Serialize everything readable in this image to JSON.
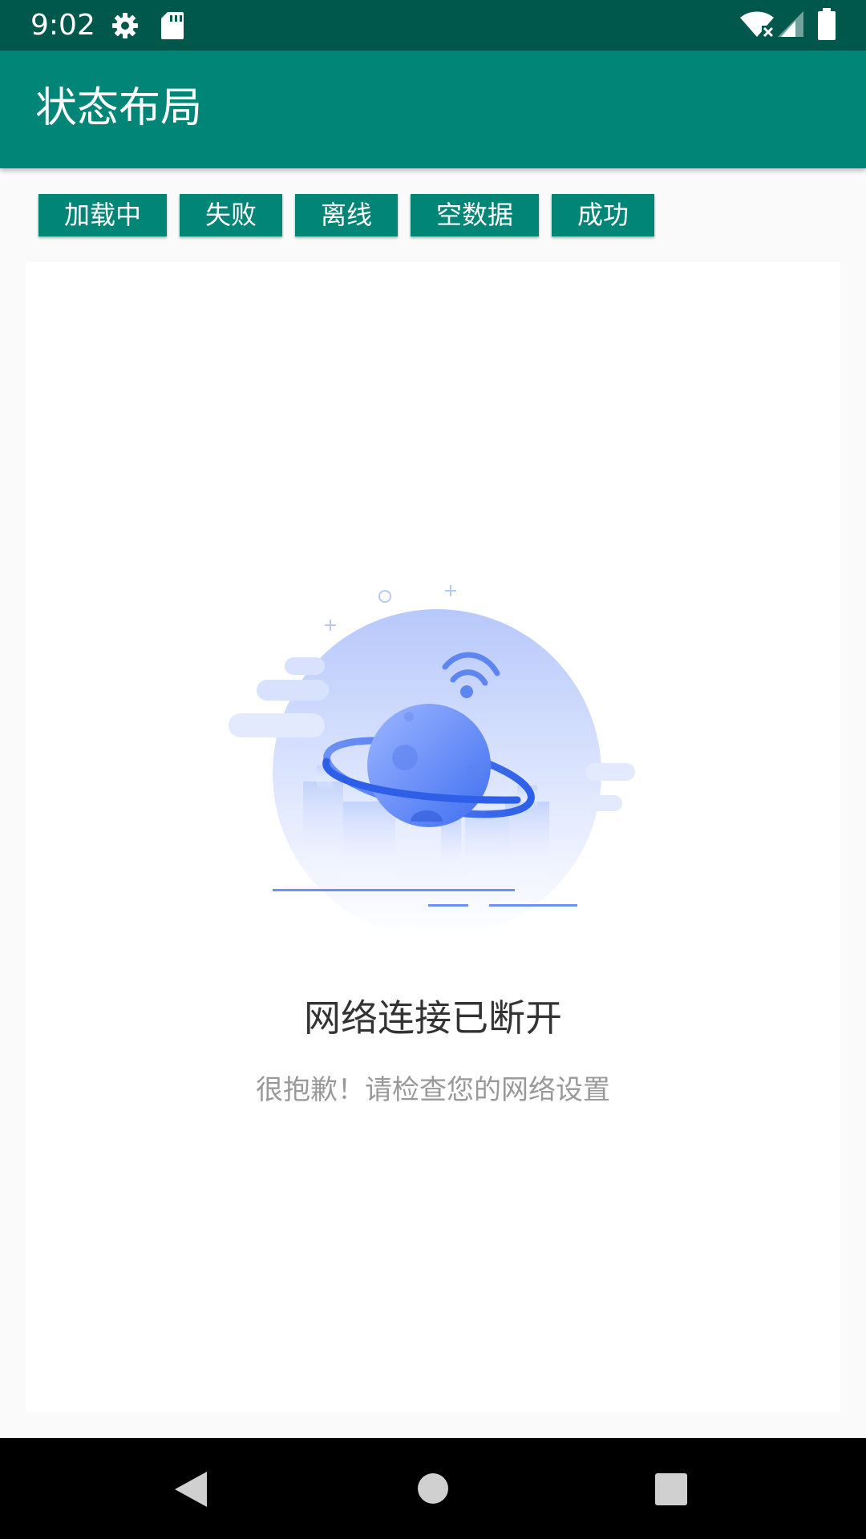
{
  "status_bar": {
    "time": "9:02",
    "icons": [
      "gear-icon",
      "sd-card-icon",
      "wifi-off-icon",
      "signal-icon",
      "battery-icon"
    ]
  },
  "app_bar": {
    "title": "状态布局"
  },
  "state_buttons": [
    {
      "label": "加载中"
    },
    {
      "label": "失败"
    },
    {
      "label": "离线"
    },
    {
      "label": "空数据"
    },
    {
      "label": "成功"
    }
  ],
  "state_view": {
    "illustration": "offline-planet-illustration",
    "title": "网络连接已断开",
    "subtitle": "很抱歉！请检查您的网络设置"
  },
  "nav_bar": {
    "icons": [
      "back-icon",
      "home-icon",
      "recents-icon"
    ]
  },
  "colors": {
    "status_bar": "#00574b",
    "primary": "#008577",
    "illustration_blue": "#4d7cf3"
  }
}
